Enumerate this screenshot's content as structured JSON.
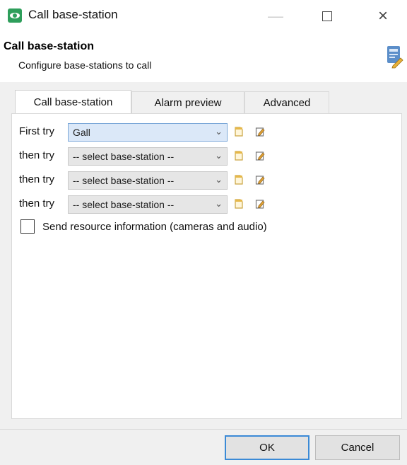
{
  "window": {
    "title": "Call base-station",
    "controls": [
      "minimize",
      "maximize",
      "close"
    ],
    "close_glyph": "×"
  },
  "header": {
    "title": "Call base-station",
    "subtitle": "Configure base-stations to call",
    "icon": "base-station-edit-icon"
  },
  "tabs": [
    {
      "label": "Call base-station",
      "active": true
    },
    {
      "label": "Alarm preview",
      "active": false
    },
    {
      "label": "Advanced",
      "active": false
    }
  ],
  "rows": [
    {
      "label": "First try",
      "value": "Gall"
    },
    {
      "label": "then try",
      "value": "-- select base-station --"
    },
    {
      "label": "then try",
      "value": "-- select base-station --"
    },
    {
      "label": "then try",
      "value": "-- select base-station --"
    }
  ],
  "checkbox": {
    "label": "Send resource information (cameras and audio)",
    "checked": false
  },
  "buttons": {
    "ok": "OK",
    "cancel": "Cancel"
  },
  "colors": {
    "accent": "#3b8ad6",
    "app_icon": "#2e9e5b",
    "selected_field": "#dbe8f8"
  }
}
